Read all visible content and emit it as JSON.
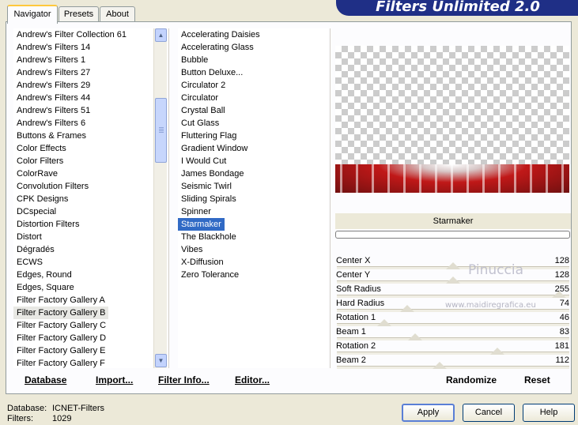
{
  "tabs": [
    {
      "label": "Navigator",
      "active": true
    },
    {
      "label": "Presets",
      "active": false
    },
    {
      "label": "About",
      "active": false
    }
  ],
  "banner": "Filters Unlimited 2.0",
  "categories": [
    "Andrew's Filter Collection 61",
    "Andrew's Filters 14",
    "Andrew's Filters 1",
    "Andrew's Filters 27",
    "Andrew's Filters 29",
    "Andrew's Filters 44",
    "Andrew's Filters 51",
    "Andrew's Filters 6",
    "Buttons & Frames",
    "Color Effects",
    "Color Filters",
    "ColorRave",
    "Convolution Filters",
    "CPK Designs",
    "DCspecial",
    "Distortion Filters",
    "Distort",
    "Dégradés",
    "ECWS",
    "Edges, Round",
    "Edges, Square",
    "Filter Factory Gallery A",
    "Filter Factory Gallery B",
    "Filter Factory Gallery C",
    "Filter Factory Gallery D",
    "Filter Factory Gallery E",
    "Filter Factory Gallery F"
  ],
  "selected_category": "Filter Factory Gallery B",
  "filters": [
    "Accelerating Daisies",
    "Accelerating Glass",
    "Bubble",
    "Button Deluxe...",
    "Circulator 2",
    "Circulator",
    "Crystal Ball",
    "Cut Glass",
    "Fluttering Flag",
    "Gradient Window",
    "I Would Cut",
    "James Bondage",
    "Seismic Twirl",
    "Sliding Spirals",
    "Spinner",
    "Starmaker",
    "The Blackhole",
    "Vibes",
    "X-Diffusion",
    "Zero Tolerance"
  ],
  "selected_filter": "Starmaker",
  "plugin_name": "Starmaker",
  "params": [
    {
      "label": "Center X",
      "value": "128",
      "level": 128
    },
    {
      "label": "Center Y",
      "value": "128",
      "level": 128
    },
    {
      "label": "Soft Radius",
      "value": "255",
      "level": 255
    },
    {
      "label": "Hard Radius",
      "value": "74",
      "level": 74
    },
    {
      "label": "Rotation 1",
      "value": "46",
      "level": 46
    },
    {
      "label": "Beam 1",
      "value": "83",
      "level": 83
    },
    {
      "label": "Rotation 2",
      "value": "181",
      "level": 181
    },
    {
      "label": "Beam 2",
      "value": "112",
      "level": 112
    }
  ],
  "bottom_buttons": {
    "database": "Database",
    "import": "Import...",
    "filter_info": "Filter Info...",
    "editor": "Editor...",
    "randomize": "Randomize",
    "reset": "Reset"
  },
  "status": {
    "database_label": "Database:",
    "database_value": "ICNET-Filters",
    "filters_label": "Filters:",
    "filters_value": "1029"
  },
  "dialog_buttons": {
    "apply": "Apply",
    "cancel": "Cancel",
    "help": "Help"
  },
  "watermark": {
    "name": "Pinuccia",
    "url": "www.maidiregrafica.eu"
  },
  "colors": {
    "banner": "#1f2f86",
    "selection": "#316ac5",
    "tab_highlight": "#ffc83c"
  }
}
